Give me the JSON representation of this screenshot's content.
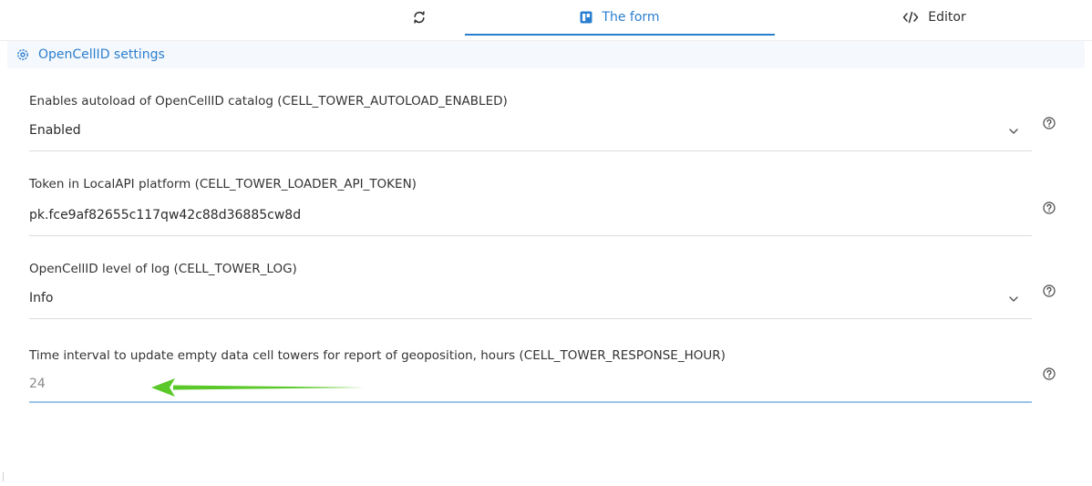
{
  "tabs": {
    "refresh_icon": "refresh-icon",
    "form_label": "The form",
    "form_icon": "form-icon",
    "editor_label": "Editor",
    "editor_icon": "code-icon"
  },
  "section": {
    "title": "OpenCellID settings",
    "icon": "settings-icon"
  },
  "fields": [
    {
      "label": "Enables autoload of OpenCellID catalog (CELL_TOWER_AUTOLOAD_ENABLED)",
      "value": "Enabled",
      "type": "select"
    },
    {
      "label": "Token in LocalAPI platform (CELL_TOWER_LOADER_API_TOKEN)",
      "value": "pk.fce9af82655c117qw42c88d36885cw8d",
      "type": "text"
    },
    {
      "label": "OpenCellID level of log (CELL_TOWER_LOG)",
      "value": "Info",
      "type": "select"
    },
    {
      "label": "Time interval to update empty data cell towers for report of geoposition, hours (CELL_TOWER_RESPONSE_HOUR)",
      "value": "24",
      "type": "number"
    }
  ],
  "colors": {
    "accent": "#2c7fd0",
    "annotation_arrow": "#5ac828"
  }
}
